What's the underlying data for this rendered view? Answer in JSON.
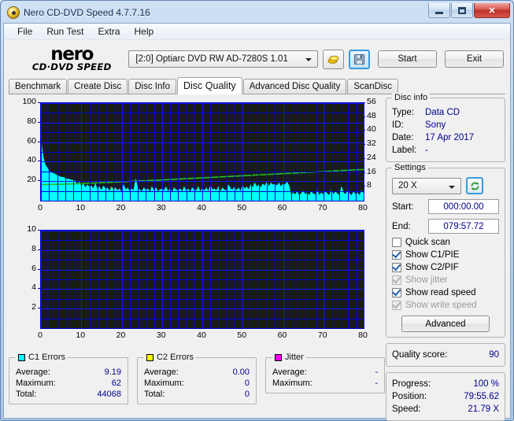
{
  "window": {
    "title": "Nero CD-DVD Speed 4.7.7.16",
    "icon": "disc-icon",
    "minimize": "minimize-icon",
    "maximize": "maximize-icon",
    "close": "✕"
  },
  "menu": {
    "items": [
      "File",
      "Run Test",
      "Extra",
      "Help"
    ]
  },
  "toolbar": {
    "logo_main": "nero",
    "logo_sub": "CD·DVD  SPEED",
    "drive": "[2:0]   Optiarc DVD RW AD-7280S 1.01",
    "eject_icon": "eject-disc-icon",
    "save_icon": "floppy-save-icon",
    "start_label": "Start",
    "exit_label": "Exit"
  },
  "tabs": {
    "items": [
      "Benchmark",
      "Create Disc",
      "Disc Info",
      "Disc Quality",
      "Advanced Disc Quality",
      "ScanDisc"
    ],
    "selected": "Disc Quality"
  },
  "disc_info": {
    "title": "Disc info",
    "rows": [
      {
        "key": "Type:",
        "value": "Data CD"
      },
      {
        "key": "ID:",
        "value": "Sony"
      },
      {
        "key": "Date:",
        "value": "17 Apr 2017"
      },
      {
        "key": "Label:",
        "value": "-"
      }
    ]
  },
  "settings": {
    "title": "Settings",
    "speed": "20 X",
    "refresh_icon": "refresh-icon",
    "start_label": "Start:",
    "start_value": "000:00.00",
    "end_label": "End:",
    "end_value": "079:57.72",
    "checkboxes": [
      {
        "label": "Quick scan",
        "checked": false,
        "enabled": true
      },
      {
        "label": "Show C1/PIE",
        "checked": true,
        "enabled": true
      },
      {
        "label": "Show C2/PIF",
        "checked": true,
        "enabled": true
      },
      {
        "label": "Show jitter",
        "checked": true,
        "enabled": false
      },
      {
        "label": "Show read speed",
        "checked": true,
        "enabled": true
      },
      {
        "label": "Show write speed",
        "checked": true,
        "enabled": false
      }
    ],
    "advanced_label": "Advanced"
  },
  "quality": {
    "label": "Quality score:",
    "value": "90"
  },
  "progress": {
    "rows": [
      {
        "key": "Progress:",
        "value": "100 %"
      },
      {
        "key": "Position:",
        "value": "79:55.62"
      },
      {
        "key": "Speed:",
        "value": "21.79 X"
      }
    ]
  },
  "stats": {
    "c1": {
      "title": "C1 Errors",
      "color": "#00FFFF",
      "rows": [
        {
          "key": "Average:",
          "value": "9.19"
        },
        {
          "key": "Maximum:",
          "value": "62"
        },
        {
          "key": "Total:",
          "value": "44068"
        }
      ]
    },
    "c2": {
      "title": "C2 Errors",
      "color": "#FFFF00",
      "rows": [
        {
          "key": "Average:",
          "value": "0.00"
        },
        {
          "key": "Maximum:",
          "value": "0"
        },
        {
          "key": "Total:",
          "value": "0"
        }
      ]
    },
    "jitter": {
      "title": "Jitter",
      "color": "#FF00FF",
      "rows": [
        {
          "key": "Average:",
          "value": "-"
        },
        {
          "key": "Maximum:",
          "value": "-"
        }
      ]
    }
  },
  "chart_data": [
    {
      "type": "area",
      "name": "c1-errors-chart",
      "title": "",
      "xlabel": "",
      "ylabel": "",
      "xlim": [
        0,
        80
      ],
      "ylim": [
        0,
        100
      ],
      "xticks": [
        0,
        10,
        20,
        30,
        40,
        50,
        60,
        70,
        80
      ],
      "yticks": [
        20,
        40,
        60,
        80,
        100
      ],
      "y2lim": [
        0,
        56
      ],
      "y2ticks": [
        8,
        16,
        24,
        32,
        40,
        48,
        56
      ],
      "grid": true,
      "grid_color": "#0000d2",
      "bg_color": "#1b1b1b",
      "series": [
        {
          "name": "C1 Errors",
          "kind": "area",
          "color": "#00FFFF",
          "axis": "left",
          "x": [
            0,
            0.5,
            1,
            1.5,
            2,
            2.5,
            3,
            3.5,
            4,
            4.5,
            5,
            5.5,
            6,
            6.5,
            7,
            7.5,
            8,
            8.5,
            9,
            9.5,
            10,
            10.5,
            11,
            11.5,
            12,
            12.5,
            13,
            13.5,
            14,
            14.5,
            15,
            15.5,
            16,
            16.5,
            17,
            17.5,
            18,
            18.5,
            19,
            19.5,
            20,
            20.5,
            21,
            21.5,
            22,
            22.5,
            23,
            23.5,
            24,
            24.5,
            25,
            25.5,
            26,
            26.5,
            27,
            27.5,
            28,
            28.5,
            29,
            29.5,
            30,
            30.5,
            31,
            31.5,
            32,
            32.5,
            33,
            33.5,
            34,
            34.5,
            35,
            35.5,
            36,
            36.5,
            37,
            37.5,
            38,
            38.5,
            39,
            39.5,
            40,
            40.5,
            41,
            41.5,
            42,
            42.5,
            43,
            43.5,
            44,
            44.5,
            45,
            45.5,
            46,
            46.5,
            47,
            47.5,
            48,
            48.5,
            49,
            49.5,
            50,
            50.5,
            51,
            51.5,
            52,
            52.5,
            53,
            53.5,
            54,
            54.5,
            55,
            55.5,
            56,
            56.5,
            57,
            57.5,
            58,
            58.5,
            59,
            59.5,
            60,
            60.5,
            61,
            61.5,
            62,
            62.5,
            63,
            63.5,
            64,
            64.5,
            65,
            65.5,
            66,
            66.5,
            67,
            67.5,
            68,
            68.5,
            69,
            69.5,
            70,
            70.5,
            71,
            71.5,
            72,
            72.5,
            73,
            73.5,
            74,
            74.5,
            75,
            75.5,
            76,
            76.5,
            77,
            77.5,
            78,
            78.5,
            79,
            79.5,
            80
          ],
          "values": [
            62,
            46,
            37,
            34,
            30,
            29,
            28,
            27,
            26,
            25,
            24,
            24,
            23,
            22,
            22,
            21,
            21,
            20,
            16,
            19,
            14,
            17,
            13,
            16,
            14,
            15,
            12,
            17,
            11,
            14,
            10,
            15,
            12,
            13,
            9,
            14,
            11,
            13,
            10,
            12,
            8,
            16,
            11,
            13,
            9,
            12,
            10,
            22,
            12,
            11,
            9,
            13,
            11,
            12,
            8,
            14,
            10,
            13,
            9,
            11,
            12,
            10,
            14,
            9,
            12,
            8,
            13,
            11,
            10,
            12,
            9,
            14,
            10,
            12,
            8,
            13,
            11,
            10,
            14,
            9,
            12,
            10,
            13,
            9,
            15,
            11,
            12,
            10,
            14,
            9,
            13,
            11,
            10,
            16,
            12,
            11,
            14,
            10,
            13,
            9,
            15,
            12,
            14,
            11,
            16,
            13,
            18,
            14,
            16,
            13,
            17,
            15,
            19,
            14,
            18,
            16,
            17,
            15,
            18,
            14,
            17,
            16,
            19,
            15,
            5,
            8,
            6,
            9,
            5,
            7,
            10,
            6,
            8,
            5,
            9,
            7,
            6,
            10,
            5,
            8,
            6,
            9,
            7,
            5,
            11,
            6,
            9,
            7,
            5,
            14,
            8,
            6,
            10,
            7,
            5,
            9,
            6,
            8,
            5,
            10,
            7,
            9,
            6,
            11,
            8,
            5,
            9,
            7,
            10,
            6,
            8,
            5,
            9,
            7,
            6
          ]
        },
        {
          "name": "Read speed",
          "kind": "line",
          "color": "#22C022",
          "axis": "right",
          "x": [
            0,
            5,
            10,
            15,
            20,
            25,
            30,
            35,
            40,
            45,
            50,
            55,
            60,
            65,
            70,
            75,
            80
          ],
          "values": [
            9.2,
            9.4,
            9.8,
            10.3,
            10.8,
            11.4,
            11.9,
            12.5,
            13.1,
            13.7,
            14.3,
            14.9,
            15.5,
            16.1,
            16.7,
            17.3,
            17.9
          ]
        }
      ]
    },
    {
      "type": "line",
      "name": "c2-errors-chart",
      "title": "",
      "xlabel": "",
      "ylabel": "",
      "xlim": [
        0,
        80
      ],
      "ylim": [
        0,
        10
      ],
      "xticks": [
        0,
        10,
        20,
        30,
        40,
        50,
        60,
        70,
        80
      ],
      "yticks": [
        2,
        4,
        6,
        8,
        10
      ],
      "grid": true,
      "grid_color": "#0000d2",
      "bg_color": "#1b1b1b",
      "series": [
        {
          "name": "C2 Errors",
          "kind": "line",
          "color": "#FFFF00",
          "axis": "left",
          "x": [],
          "values": []
        }
      ]
    }
  ]
}
